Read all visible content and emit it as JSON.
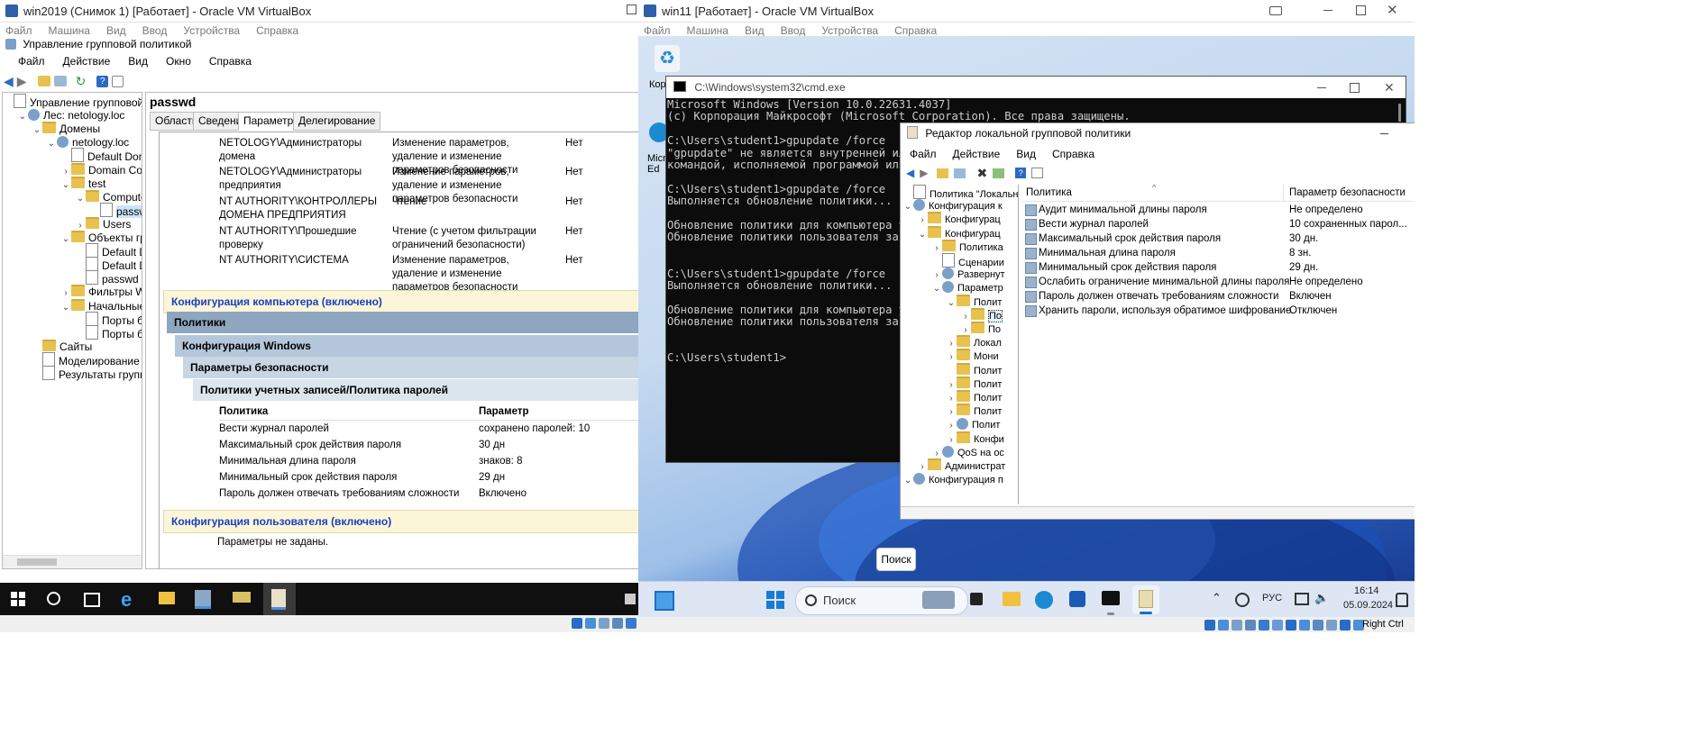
{
  "left_vm": {
    "title": "win2019 (Снимок 1) [Работает] - Oracle VM VirtualBox",
    "menu": [
      "Файл",
      "Машина",
      "Вид",
      "Ввод",
      "Устройства",
      "Справка"
    ],
    "app_title": "Управление групповой политикой",
    "app_menu": [
      "Файл",
      "Действие",
      "Вид",
      "Окно",
      "Справка"
    ],
    "tree": [
      {
        "label": "Управление групповой полит",
        "indent": 0,
        "icon": "doc",
        "tw": ""
      },
      {
        "label": "Лес: netology.loc",
        "indent": 1,
        "icon": "gear",
        "tw": "⌄"
      },
      {
        "label": "Домены",
        "indent": 2,
        "icon": "fold",
        "tw": "⌄"
      },
      {
        "label": "netology.loc",
        "indent": 3,
        "icon": "gear",
        "tw": "⌄"
      },
      {
        "label": "Default Domain",
        "indent": 4,
        "icon": "doc",
        "tw": ""
      },
      {
        "label": "Domain Contro",
        "indent": 4,
        "icon": "fold",
        "tw": "›"
      },
      {
        "label": "test",
        "indent": 4,
        "icon": "fold",
        "tw": "⌄"
      },
      {
        "label": "Computers",
        "indent": 5,
        "icon": "fold",
        "tw": "⌄"
      },
      {
        "label": "passwd",
        "indent": 6,
        "icon": "doc",
        "tw": "",
        "selected": true
      },
      {
        "label": "Users",
        "indent": 5,
        "icon": "fold",
        "tw": "›"
      },
      {
        "label": "Объекты групп",
        "indent": 4,
        "icon": "fold",
        "tw": "⌄"
      },
      {
        "label": "Default Dom",
        "indent": 5,
        "icon": "doc",
        "tw": ""
      },
      {
        "label": "Default Dom",
        "indent": 5,
        "icon": "doc",
        "tw": ""
      },
      {
        "label": "passwd",
        "indent": 5,
        "icon": "doc",
        "tw": ""
      },
      {
        "label": "Фильтры WMI",
        "indent": 4,
        "icon": "fold",
        "tw": "›"
      },
      {
        "label": "Начальные объ",
        "indent": 4,
        "icon": "fold",
        "tw": "⌄"
      },
      {
        "label": "Порты бран",
        "indent": 5,
        "icon": "doc",
        "tw": ""
      },
      {
        "label": "Порты бран",
        "indent": 5,
        "icon": "doc",
        "tw": ""
      },
      {
        "label": "Сайты",
        "indent": 2,
        "icon": "fold",
        "tw": ""
      },
      {
        "label": "Моделирование групп",
        "indent": 2,
        "icon": "doc",
        "tw": ""
      },
      {
        "label": "Результаты групповой",
        "indent": 2,
        "icon": "doc",
        "tw": ""
      }
    ],
    "gpo_name": "passwd",
    "tabs": [
      "Область",
      "Сведения",
      "Параметры",
      "Делегирование"
    ],
    "delegation": [
      {
        "who": "NETOLOGY\\Администраторы домена",
        "perm": "Изменение параметров, удаление и изменение параметров безопасности",
        "inh": "Нет"
      },
      {
        "who": "NETOLOGY\\Администраторы предприятия",
        "perm": "Изменение параметров, удаление и изменение параметров безопасности",
        "inh": "Нет"
      },
      {
        "who": "NT AUTHORITY\\КОНТРОЛЛЕРЫ ДОМЕНА ПРЕДПРИЯТИЯ",
        "perm": "Чтение",
        "inh": "Нет"
      },
      {
        "who": "NT AUTHORITY\\Прошедшие проверку",
        "perm": "Чтение (с учетом фильтрации ограничений безопасности)",
        "inh": "Нет"
      },
      {
        "who": "NT AUTHORITY\\СИСТЕМА",
        "perm": "Изменение параметров, удаление и изменение параметров безопасности",
        "inh": "Нет"
      }
    ],
    "computer_config": "Конфигурация компьютера (включено)",
    "policies": "Политики",
    "win_config": "Конфигурация Windows",
    "security": "Параметры безопасности",
    "account_policy": "Политики учетных записей/Политика паролей",
    "col_policy": "Политика",
    "col_param": "Параметр",
    "password_rows": [
      {
        "name": "Вести журнал паролей",
        "value": "сохранено паролей: 10"
      },
      {
        "name": "Максимальный срок действия пароля",
        "value": "30 дн"
      },
      {
        "name": "Минимальная длина пароля",
        "value": "знаков: 8"
      },
      {
        "name": "Минимальный срок действия пароля",
        "value": "29 дн"
      },
      {
        "name": "Пароль должен отвечать требованиям сложности",
        "value": "Включено"
      }
    ],
    "user_config": "Конфигурация пользователя (включено)",
    "no_params": "Параметры не заданы."
  },
  "right_vm": {
    "title": "win11 [Работает] - Oracle VM VirtualBox",
    "menu": [
      "Файл",
      "Машина",
      "Вид",
      "Ввод",
      "Устройства",
      "Справка"
    ],
    "desktop_icons": [
      "Корз",
      "Micr Ed"
    ],
    "cmd_title": "C:\\Windows\\system32\\cmd.exe",
    "cmd_lines": [
      "Microsoft Windows [Version 10.0.22631.4037]",
      "(c) Корпорация Майкрософт (Microsoft Corporation). Все права защищены.",
      "",
      "C:\\Users\\student1>gpupdate /force",
      "\"gpupdate\" не является внутренней или в",
      "командой, исполняемой программой или па",
      "",
      "C:\\Users\\student1>gpupdate /force",
      "Выполняется обновление политики...",
      "",
      "Обновление политики для компьютера усп",
      "Обновление политики пользователя завер",
      "",
      "",
      "C:\\Users\\student1>gpupdate /force",
      "Выполняется обновление политики...",
      "",
      "Обновление политики для компьютера усп",
      "Обновление политики пользователя завер",
      "",
      "",
      "C:\\Users\\student1>"
    ],
    "gpedit_title": "Редактор локальной групповой политики",
    "gpedit_menu": [
      "Файл",
      "Действие",
      "Вид",
      "Справка"
    ],
    "gp_tree": [
      {
        "label": "Политика \"Локальн",
        "indent": 0,
        "tw": "",
        "icon": "doc"
      },
      {
        "label": "Конфигурация к",
        "indent": 0,
        "tw": "⌄",
        "icon": "gear"
      },
      {
        "label": "Конфигурац",
        "indent": 1,
        "tw": "›",
        "icon": "fold"
      },
      {
        "label": "Конфигурац",
        "indent": 1,
        "tw": "⌄",
        "icon": "fold"
      },
      {
        "label": "Политика",
        "indent": 2,
        "tw": "›",
        "icon": "fold"
      },
      {
        "label": "Сценарии",
        "indent": 2,
        "tw": "",
        "icon": "doc"
      },
      {
        "label": "Развернут",
        "indent": 2,
        "tw": "›",
        "icon": "gear"
      },
      {
        "label": "Параметр",
        "indent": 2,
        "tw": "⌄",
        "icon": "gear"
      },
      {
        "label": "Полит",
        "indent": 3,
        "tw": "⌄",
        "icon": "fold"
      },
      {
        "label": "По",
        "indent": 4,
        "tw": "›",
        "icon": "fold",
        "selected": true
      },
      {
        "label": "По",
        "indent": 4,
        "tw": "›",
        "icon": "fold"
      },
      {
        "label": "Локал",
        "indent": 3,
        "tw": "›",
        "icon": "fold"
      },
      {
        "label": "Мони",
        "indent": 3,
        "tw": "›",
        "icon": "fold"
      },
      {
        "label": "Полит",
        "indent": 3,
        "tw": "",
        "icon": "fold"
      },
      {
        "label": "Полит",
        "indent": 3,
        "tw": "›",
        "icon": "fold"
      },
      {
        "label": "Полит",
        "indent": 3,
        "tw": "›",
        "icon": "fold"
      },
      {
        "label": "Полит",
        "indent": 3,
        "tw": "›",
        "icon": "fold"
      },
      {
        "label": "Полит",
        "indent": 3,
        "tw": "›",
        "icon": "gear"
      },
      {
        "label": "Конфи",
        "indent": 3,
        "tw": "›",
        "icon": "fold"
      },
      {
        "label": "QoS на ос",
        "indent": 2,
        "tw": "›",
        "icon": "gear"
      },
      {
        "label": "Администрат",
        "indent": 1,
        "tw": "›",
        "icon": "fold"
      },
      {
        "label": "Конфигурация п",
        "indent": 0,
        "tw": "⌄",
        "icon": "gear"
      }
    ],
    "gp_col_policy": "Политика",
    "gp_col_param": "Параметр безопасности",
    "gp_rows": [
      {
        "name": "Аудит минимальной длины пароля",
        "value": "Не определено"
      },
      {
        "name": "Вести журнал паролей",
        "value": "10 сохраненных парол..."
      },
      {
        "name": "Максимальный срок действия пароля",
        "value": "30 дн."
      },
      {
        "name": "Минимальная длина пароля",
        "value": "8 зн."
      },
      {
        "name": "Минимальный срок действия пароля",
        "value": "29 дн."
      },
      {
        "name": "Ослабить ограничение минимальной длины пароля",
        "value": "Не определено"
      },
      {
        "name": "Пароль должен отвечать требованиям сложности",
        "value": "Включен"
      },
      {
        "name": "Хранить пароли, используя обратимое шифрование",
        "value": "Отключен"
      }
    ],
    "search_tooltip": "Поиск",
    "taskbar_search": "Поиск",
    "lang": "РУС",
    "time": "16:14",
    "date": "05.09.2024",
    "host_key": "Right Ctrl"
  }
}
